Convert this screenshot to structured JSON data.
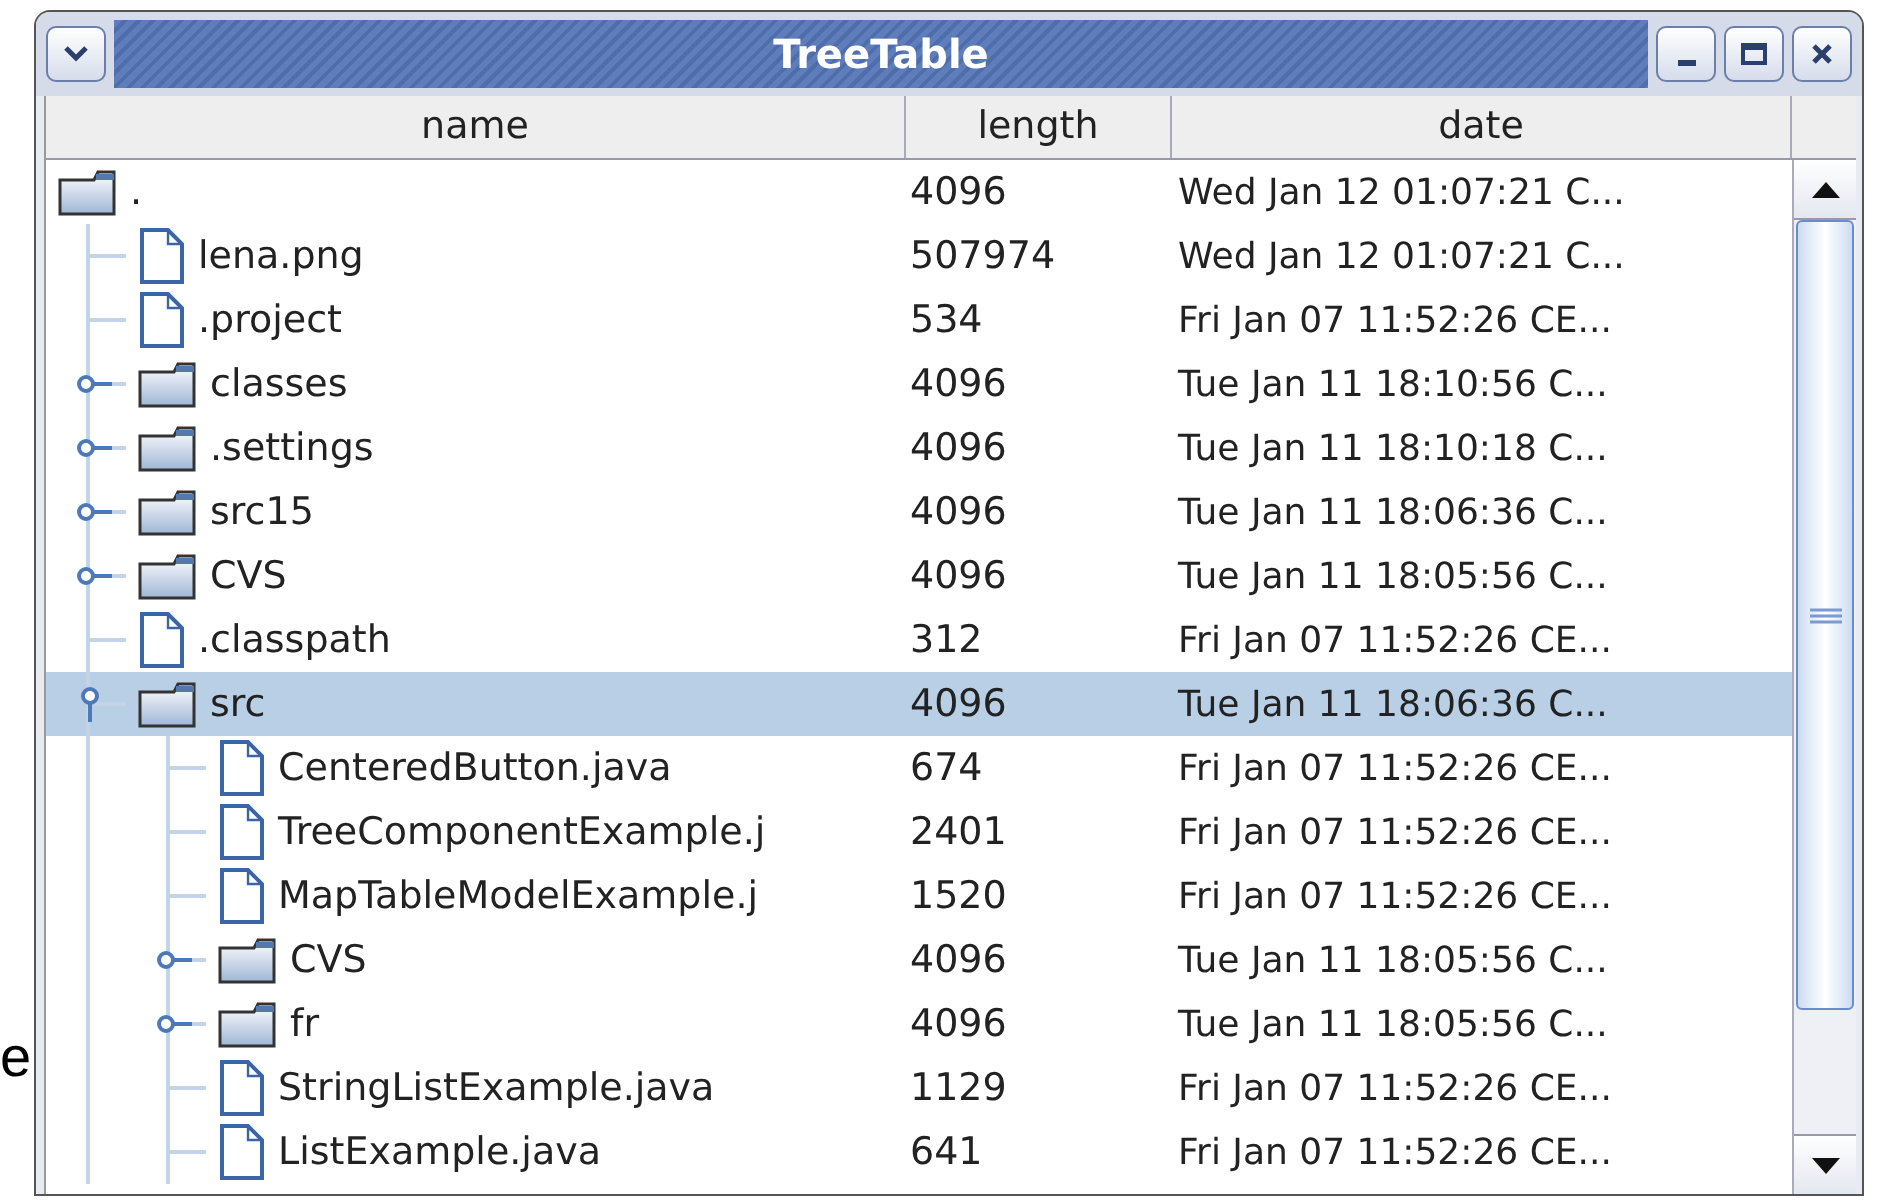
{
  "background_text": "e",
  "window": {
    "title": "TreeTable"
  },
  "table": {
    "columns": [
      "name",
      "length",
      "date"
    ],
    "rows": [
      {
        "kind": "folder",
        "name": ".",
        "length": "4096",
        "date": "Wed Jan 12 01:07:21 C...",
        "selected": false,
        "children": [
          {
            "kind": "file",
            "name": "lena.png",
            "length": "507974",
            "date": "Wed Jan 12 01:07:21 C...",
            "selected": false
          },
          {
            "kind": "file",
            "name": ".project",
            "length": "534",
            "date": "Fri Jan 07 11:52:26 CE...",
            "selected": false
          },
          {
            "kind": "folder",
            "name": "classes",
            "length": "4096",
            "date": "Tue Jan 11 18:10:56 C...",
            "expanded": false,
            "selected": false
          },
          {
            "kind": "folder",
            "name": ".settings",
            "length": "4096",
            "date": "Tue Jan 11 18:10:18 C...",
            "expanded": false,
            "selected": false
          },
          {
            "kind": "folder",
            "name": "src15",
            "length": "4096",
            "date": "Tue Jan 11 18:06:36 C...",
            "expanded": false,
            "selected": false
          },
          {
            "kind": "folder",
            "name": "CVS",
            "length": "4096",
            "date": "Tue Jan 11 18:05:56 C...",
            "expanded": false,
            "selected": false
          },
          {
            "kind": "file",
            "name": ".classpath",
            "length": "312",
            "date": "Fri Jan 07 11:52:26 CE...",
            "selected": false
          },
          {
            "kind": "folder",
            "name": "src",
            "length": "4096",
            "date": "Tue Jan 11 18:06:36 C...",
            "expanded": true,
            "selected": true,
            "children": [
              {
                "kind": "file",
                "name": "CenteredButton.java",
                "length": "674",
                "date": "Fri Jan 07 11:52:26 CE...",
                "selected": false
              },
              {
                "kind": "file",
                "name": "TreeComponentExample.j",
                "length": "2401",
                "date": "Fri Jan 07 11:52:26 CE...",
                "selected": false
              },
              {
                "kind": "file",
                "name": "MapTableModelExample.j",
                "length": "1520",
                "date": "Fri Jan 07 11:52:26 CE...",
                "selected": false
              },
              {
                "kind": "folder",
                "name": "CVS",
                "length": "4096",
                "date": "Tue Jan 11 18:05:56 C...",
                "expanded": false,
                "selected": false
              },
              {
                "kind": "folder",
                "name": "fr",
                "length": "4096",
                "date": "Tue Jan 11 18:05:56 C...",
                "expanded": false,
                "selected": false
              },
              {
                "kind": "file",
                "name": "StringListExample.java",
                "length": "1129",
                "date": "Fri Jan 07 11:52:26 CE...",
                "selected": false
              },
              {
                "kind": "file",
                "name": "ListExample.java",
                "length": "641",
                "date": "Fri Jan 07 11:52:26 CE...",
                "selected": false
              }
            ]
          }
        ]
      }
    ]
  }
}
